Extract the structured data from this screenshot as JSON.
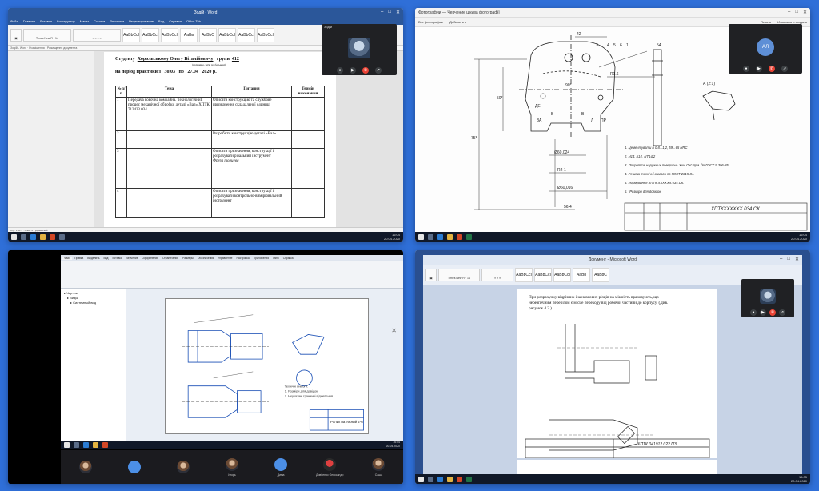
{
  "panel1": {
    "window_title": "Зодій - Word",
    "ribbon_tabs": [
      "Файл",
      "Главная",
      "Вставка",
      "Конструктор",
      "Макет",
      "Ссылки",
      "Рассылки",
      "Рецензирование",
      "Вид",
      "Справка",
      "Office Tab"
    ],
    "style_samples": [
      "AaBbCcI",
      "AaBbCcI",
      "AaBbCcI",
      "АаВв",
      "AaBbC",
      "AaBbCcI",
      "AaBbCcI",
      "AaBbCcI"
    ],
    "doc": {
      "student_label": "Студенту",
      "student_name": "Хорольському Олегу Віталійовичу",
      "group_label": "групи",
      "group_value": "412",
      "student_hint": "(прізвище, ім'я, по-батькові)",
      "period_label": "на період практики з",
      "date_from": "30.03",
      "to_label": "по",
      "date_to": "27.04",
      "year": "2020 р.",
      "table_headers": [
        "№ з/п",
        "Тема",
        "Питання",
        "Термін виконання"
      ],
      "rows": [
        {
          "num": "1",
          "topic": "Передача ковочна комбайна. Технологічний процес механічної обробки деталі «Вал» ХПТК 713423.034",
          "question": "Описати конструкцію та службове призначення складальної одиниці"
        },
        {
          "num": "2",
          "topic": "",
          "question": "Розробити конструкцію деталі «Вал»"
        },
        {
          "num": "3",
          "topic": "",
          "question": "Описати призначення, конструкції і розрахувати різальний інструмент",
          "extra": "Фреза торцева"
        },
        {
          "num": "4",
          "topic": "",
          "question": "Описати призначення, конструкції і розрахувати контрольно-вимірювальний інструмент"
        }
      ]
    },
    "call": {
      "title": "Зодій"
    },
    "tray_time": "16:04",
    "tray_date": "20.04.2020"
  },
  "panel2": {
    "window_title": "Фотографии — Черчение шкива фотографії",
    "toolbar_left": [
      "Все фотографии",
      "Добавить в"
    ],
    "toolbar_right": [
      "Печать",
      "Изменить и создать"
    ],
    "drawing": {
      "dims_top": [
        "42",
        "3",
        "4",
        "5",
        "6",
        "1"
      ],
      "angle": "90°",
      "notes": [
        "1. Цементувати h 0,8...1,2, 59...65 HRC",
        "2. H14, h14, ±IT14/2",
        "3. Покриття наружних поверхонь Хим.Окс.прм. до ГОСТ 9.306-85",
        "4. Решта технічні вимоги по ГОСТ 2015-84.",
        "5. Нормування ХПТК.ХХХХХХ.034.СК.",
        "6. *Розміри для довідок"
      ],
      "stamp": "ХПТКХХХХХХ.034.СК",
      "section": "А (2:1)",
      "labels": [
        "ДЕ",
        "Б",
        "В",
        "ЗА",
        "Л",
        "ПР",
        "50*",
        "75*",
        "Ø60,024",
        "R1.6",
        "Ø60,016",
        "54",
        "R2-1",
        "56.4"
      ]
    },
    "call": {
      "initials": "АЛ"
    },
    "tray_time": "16:04",
    "tray_date": "20.04.2020"
  },
  "panel3": {
    "window_title": "КОМПАС-3D v18",
    "ribbon_tabs": [
      "Файл",
      "Правка",
      "Выделить",
      "Вид",
      "Вставка",
      "Черчение",
      "Оформление",
      "Ограничения",
      "Размеры",
      "Обозначения",
      "Управление",
      "Настройка",
      "Приложения",
      "Окно",
      "Справка"
    ],
    "tree_items": [
      "Чертеж",
      "Виды",
      "Системный вид"
    ],
    "sheet": {
      "stamp": "Ролик натяжний 2-6"
    },
    "participants": [
      {
        "name": ""
      },
      {
        "name": ""
      },
      {
        "name": ""
      },
      {
        "name": "Игорь"
      },
      {
        "name": "Дима"
      },
      {
        "name": "Довбенко Олександр"
      },
      {
        "name": "Саша"
      }
    ],
    "tray_time": "16:04",
    "tray_date": "20.04.2020"
  },
  "panel4": {
    "window_title": "Документ - Microsoft Word",
    "paragraph_lines": [
      "При розрахунку відрізних і канавкових різців на міцність враховують, що",
      "небезпечним перерізом є місце переходу від робочої частини до корпусу. (Див.",
      "рисунок 4.3.)"
    ],
    "drawing_stamp": "ХПТК.041912.022 ПЗ",
    "tray_time": "16:05",
    "tray_date": "20.04.2020"
  }
}
